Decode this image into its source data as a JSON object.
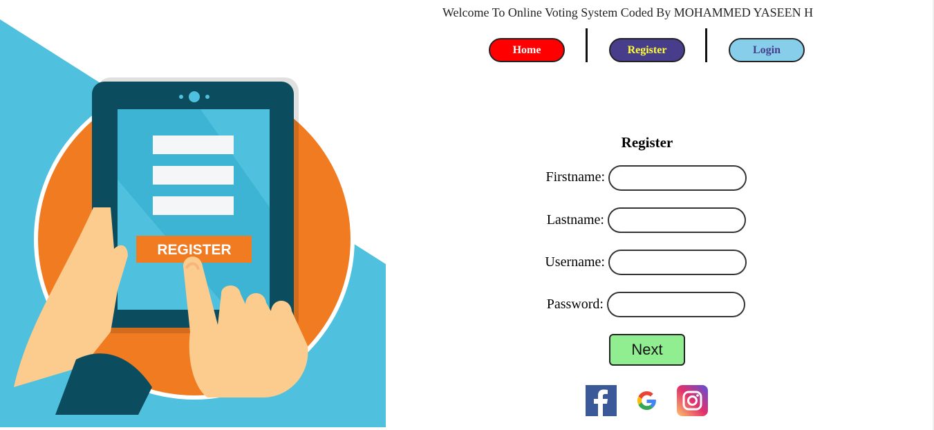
{
  "header": {
    "welcome_text": "Welcome To Online Voting System Coded By MOHAMMED YASEEN H"
  },
  "nav": {
    "home_label": "Home",
    "register_label": "Register",
    "login_label": "Login"
  },
  "hero": {
    "register_badge": "REGISTER"
  },
  "form": {
    "title": "Register",
    "firstname_label": "Firstname:",
    "firstname_value": "",
    "lastname_label": "Lastname:",
    "lastname_value": "",
    "username_label": "Username:",
    "username_value": "",
    "password_label": "Password:",
    "password_value": "",
    "next_label": "Next"
  },
  "social": {
    "icons": [
      "facebook-icon",
      "google-icon",
      "instagram-icon"
    ],
    "facebook_color": "#3b5998",
    "instagram_color": "#c13584"
  },
  "colors": {
    "home": "#ff0000",
    "register": "#483d8b",
    "register_text": "#ffff33",
    "login": "#87ceeb",
    "next": "#90ee90",
    "hero_blue": "#4fc0dd",
    "hero_orange": "#f07b20"
  }
}
